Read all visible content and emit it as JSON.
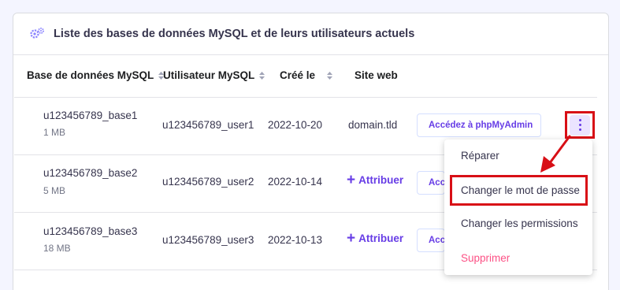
{
  "header": {
    "title": "Liste des bases de données MySQL et de leurs utilisateurs actuels",
    "icon": "gears-icon"
  },
  "columns": [
    {
      "label": "Base de données MySQL",
      "sortable": true
    },
    {
      "label": "Utilisateur MySQL",
      "sortable": true
    },
    {
      "label": "Créé le",
      "sortable": true
    },
    {
      "label": "Site web",
      "sortable": false
    }
  ],
  "rows": [
    {
      "database": "u123456789_base1",
      "size": "1 MB",
      "user": "u123456789_user1",
      "created": "2022-10-20",
      "website": "domain.tld",
      "action": "Accédez à phpMyAdmin"
    },
    {
      "database": "u123456789_base2",
      "size": "5 MB",
      "user": "u123456789_user2",
      "created": "2022-10-14",
      "website_action": "Attribuer",
      "action": "Accédez à phpMyAdmin"
    },
    {
      "database": "u123456789_base3",
      "size": "18 MB",
      "user": "u123456789_user3",
      "created": "2022-10-13",
      "website_action": "Attribuer",
      "action": "Accédez à phpMyAdmin"
    }
  ],
  "menu": {
    "items": [
      {
        "label": "Réparer"
      },
      {
        "label": "Changer le mot de passe",
        "highlighted": true
      },
      {
        "label": "Changer les permissions"
      },
      {
        "label": "Supprimer",
        "danger": true
      }
    ]
  },
  "colors": {
    "accent": "#673de6",
    "highlight": "#d80f16",
    "danger": "#fc5185"
  }
}
